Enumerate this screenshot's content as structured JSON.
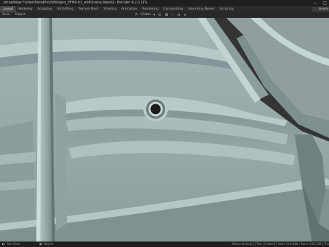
{
  "window": {
    "title": "..sktop\\New Folder\\BlendProd\\Widgen_VFHX-01_withScene.blend] - Blender 4.2.1 LTS",
    "minimize_glyph": "—",
    "maximize_glyph": "□"
  },
  "workspaces": [
    "Layout",
    "Modeling",
    "Sculpting",
    "UV Editing",
    "Texture Paint",
    "Shading",
    "Animation",
    "Rendering",
    "Compositing",
    "Geometry Nodes",
    "Scripting"
  ],
  "active_workspace": "Layout",
  "scene": {
    "name": "Scene",
    "icon": "scene-icon"
  },
  "header": {
    "view_label": "View",
    "object_label": "Object",
    "transform_orientation": "Global"
  },
  "status": {
    "left_label": "Pan View",
    "mid_label": "Object",
    "right_text": "Status alerts(1) | Sky (Cricket) | Verts 241,288 | Faces 242,188 | Tris 481,988"
  },
  "colors": {
    "background": "#303030",
    "model_surface": "#95a8a7",
    "model_highlight": "#c0d3d1",
    "model_shadow": "#566867",
    "active_tab": "#474747"
  }
}
